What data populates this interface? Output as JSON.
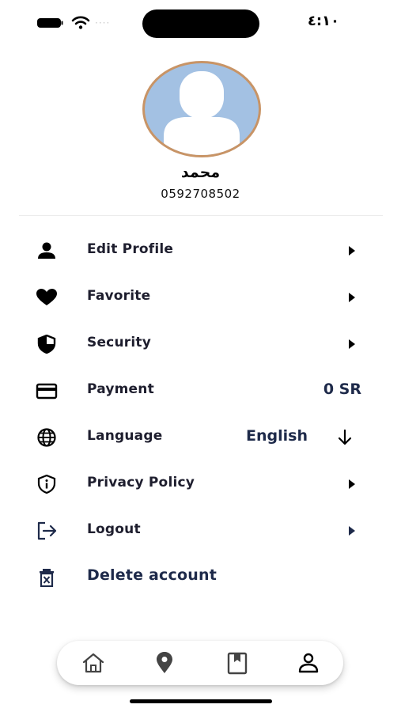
{
  "status_bar": {
    "time": "٤:١٠",
    "signal_dots": "····"
  },
  "profile": {
    "name": "محمد",
    "phone": "0592708502"
  },
  "menu": {
    "edit_profile": {
      "label": "Edit Profile",
      "icon": "person-icon"
    },
    "favorite": {
      "label": "Favorite",
      "icon": "heart-icon"
    },
    "security": {
      "label": "Security",
      "icon": "shield-icon"
    },
    "payment": {
      "label": "Payment",
      "icon": "credit-card-icon",
      "value": "0 SR"
    },
    "language": {
      "label": "Language",
      "icon": "globe-icon",
      "value": "English"
    },
    "privacy_policy": {
      "label": "Privacy Policy",
      "icon": "info-shield-icon"
    },
    "logout": {
      "label": "Logout",
      "icon": "logout-icon"
    },
    "delete_account": {
      "label": "Delete account",
      "icon": "trash-icon"
    }
  },
  "bottom_nav": {
    "items": [
      {
        "icon": "home-icon"
      },
      {
        "icon": "location-pin-icon"
      },
      {
        "icon": "bookmark-icon"
      },
      {
        "icon": "profile-icon",
        "active": true
      }
    ]
  },
  "colors": {
    "avatar_bg": "#a3c1e3",
    "avatar_border": "#c89466",
    "text_dark": "#1e1e2e",
    "value_text": "#1e2a4a"
  }
}
